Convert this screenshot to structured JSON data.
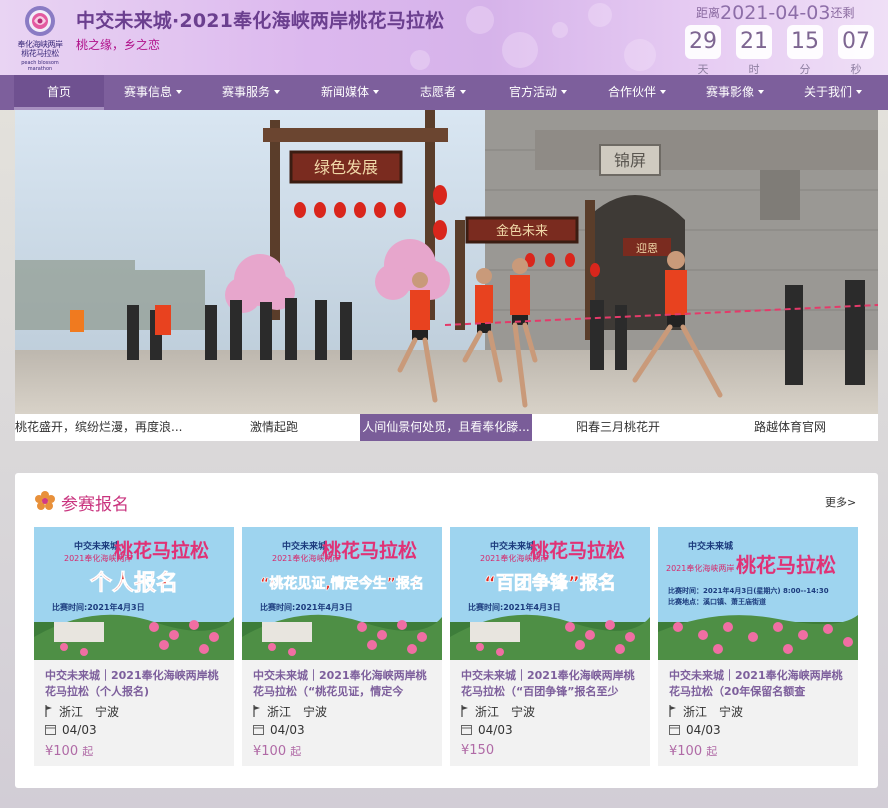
{
  "header": {
    "logo_text_line1": "奉化海峡两岸",
    "logo_text_line2": "桃花马拉松",
    "logo_sub": "peach blossom marathon",
    "title": "中交未来城·2021奉化海峡两岸桃花马拉松",
    "slogan": "桃之缘，乡之恋",
    "countdown": {
      "prefix": "距离",
      "date": "2021-04-03",
      "suffix": "还剩",
      "days": "29",
      "hours": "21",
      "minutes": "15",
      "seconds": "07",
      "days_unit": "天",
      "hours_unit": "时",
      "minutes_unit": "分",
      "seconds_unit": "秒"
    }
  },
  "nav": {
    "items": [
      {
        "label": "首页"
      },
      {
        "label": "赛事信息"
      },
      {
        "label": "赛事服务"
      },
      {
        "label": "新闻媒体"
      },
      {
        "label": "志愿者"
      },
      {
        "label": "官方活动"
      },
      {
        "label": "合作伙伴"
      },
      {
        "label": "赛事影像"
      },
      {
        "label": "关于我们"
      }
    ]
  },
  "hero": {
    "arch_sign_top": "绿色发展",
    "arch_sign_mid": "金色未来",
    "arch_sign_right": "迎恩",
    "wall_sign": "锦屏",
    "captions": [
      {
        "label": "桃花盛开，缤纷烂漫，再度浪..."
      },
      {
        "label": "激情起跑"
      },
      {
        "label": "人间仙景何处觅，且看奉化滕..."
      },
      {
        "label": "阳春三月桃花开"
      },
      {
        "label": "路越体育官网"
      }
    ]
  },
  "registration": {
    "title": "参赛报名",
    "more": "更多>",
    "cards": [
      {
        "poster_brand": "中交未来城",
        "poster_year": "2021奉化海峡两岸",
        "poster_main": "桃花马拉松",
        "poster_banner": "个人报名",
        "poster_time": "比赛时间:2021年4月3日",
        "title": "中交未来城｜2021奉化海峡两岸桃花马拉松（个人报名)",
        "location": "浙江　宁波",
        "date": "04/03",
        "price": "¥100",
        "price_suffix": "起"
      },
      {
        "poster_brand": "中交未来城",
        "poster_year": "2021奉化海峡两岸",
        "poster_main": "桃花马拉松",
        "poster_banner": "“桃花见证,情定今生”报名",
        "poster_time": "比赛时间:2021年4月3日",
        "title": "中交未来城｜2021奉化海峡两岸桃花马拉松（“桃花见证，情定今",
        "location": "浙江　宁波",
        "date": "04/03",
        "price": "¥100",
        "price_suffix": "起"
      },
      {
        "poster_brand": "中交未来城",
        "poster_year": "2021奉化海峡两岸",
        "poster_main": "桃花马拉松",
        "poster_banner": "“百团争锋”报名",
        "poster_time": "比赛时间:2021年4月3日",
        "title": "中交未来城｜2021奉化海峡两岸桃花马拉松（“百团争锋”报名至少",
        "location": "浙江　宁波",
        "date": "04/03",
        "price": "¥150",
        "price_suffix": ""
      },
      {
        "poster_brand": "中交未来城",
        "poster_year": "2021奉化海峡两岸",
        "poster_main": "桃花马拉松",
        "poster_banner": "",
        "poster_time": "比赛时间：2021年4月3日(星期六) 8:00--14:30",
        "poster_place": "比赛地点：溪口镇、萧王庙街道",
        "title": "中交未来城｜2021奉化海峡两岸桃花马拉松（20年保留名额查",
        "location": "浙江　宁波",
        "date": "04/03",
        "price": "¥100",
        "price_suffix": "起"
      }
    ]
  },
  "colors": {
    "nav": "#7d5f9c",
    "accent_pink": "#c9337e",
    "card_title": "#7d5f9c"
  }
}
